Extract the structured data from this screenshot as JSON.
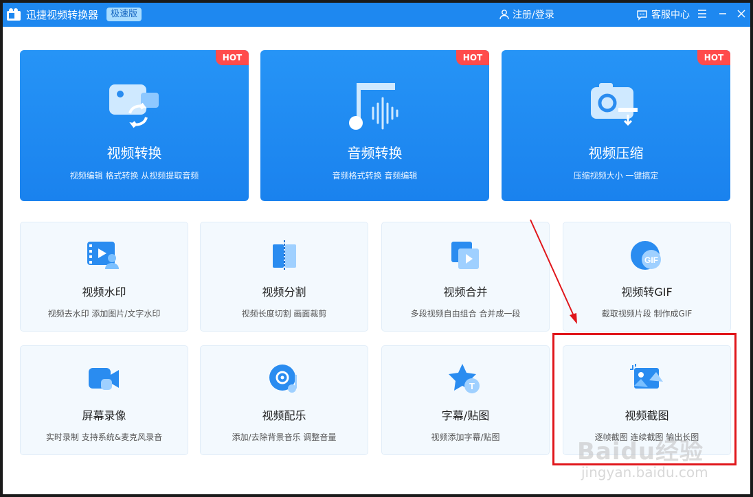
{
  "app": {
    "title": "迅捷视频转换器",
    "edition": "极速版"
  },
  "header": {
    "login": "注册/登录",
    "service": "客服中心"
  },
  "hot_label": "HOT",
  "big_cards": [
    {
      "title": "视频转换",
      "desc": "视频编辑 格式转换 从视频提取音频",
      "icon": "video-convert-icon"
    },
    {
      "title": "音频转换",
      "desc": "音频格式转换 音频编辑",
      "icon": "music-note-icon"
    },
    {
      "title": "视频压缩",
      "desc": "压缩视频大小 一键搞定",
      "icon": "camera-compress-icon"
    }
  ],
  "tools_row1": [
    {
      "title": "视频水印",
      "desc": "视频去水印 添加图片/文字水印",
      "icon": "watermark-icon"
    },
    {
      "title": "视频分割",
      "desc": "视频长度切割 画面裁剪",
      "icon": "split-icon"
    },
    {
      "title": "视频合并",
      "desc": "多段视频自由组合 合并成一段",
      "icon": "merge-icon"
    },
    {
      "title": "视频转GIF",
      "desc": "截取视频片段 制作成GIF",
      "icon": "gif-icon"
    }
  ],
  "tools_row2": [
    {
      "title": "屏幕录像",
      "desc": "实时录制 支持系统&麦克风录音",
      "icon": "screen-record-icon"
    },
    {
      "title": "视频配乐",
      "desc": "添加/去除背景音乐 调整音量",
      "icon": "music-disc-icon"
    },
    {
      "title": "字幕/贴图",
      "desc": "视频添加字幕/贴图",
      "icon": "subtitle-star-icon"
    },
    {
      "title": "视频截图",
      "desc": "逐帧截图 连续截图 输出长图",
      "icon": "screenshot-icon"
    }
  ],
  "watermark": {
    "text": "Baidu经验",
    "sub": "jingyan.baidu.com"
  },
  "colors": {
    "accent": "#1e88f0",
    "hot": "#ff4b4b",
    "highlight": "#e0161b"
  }
}
